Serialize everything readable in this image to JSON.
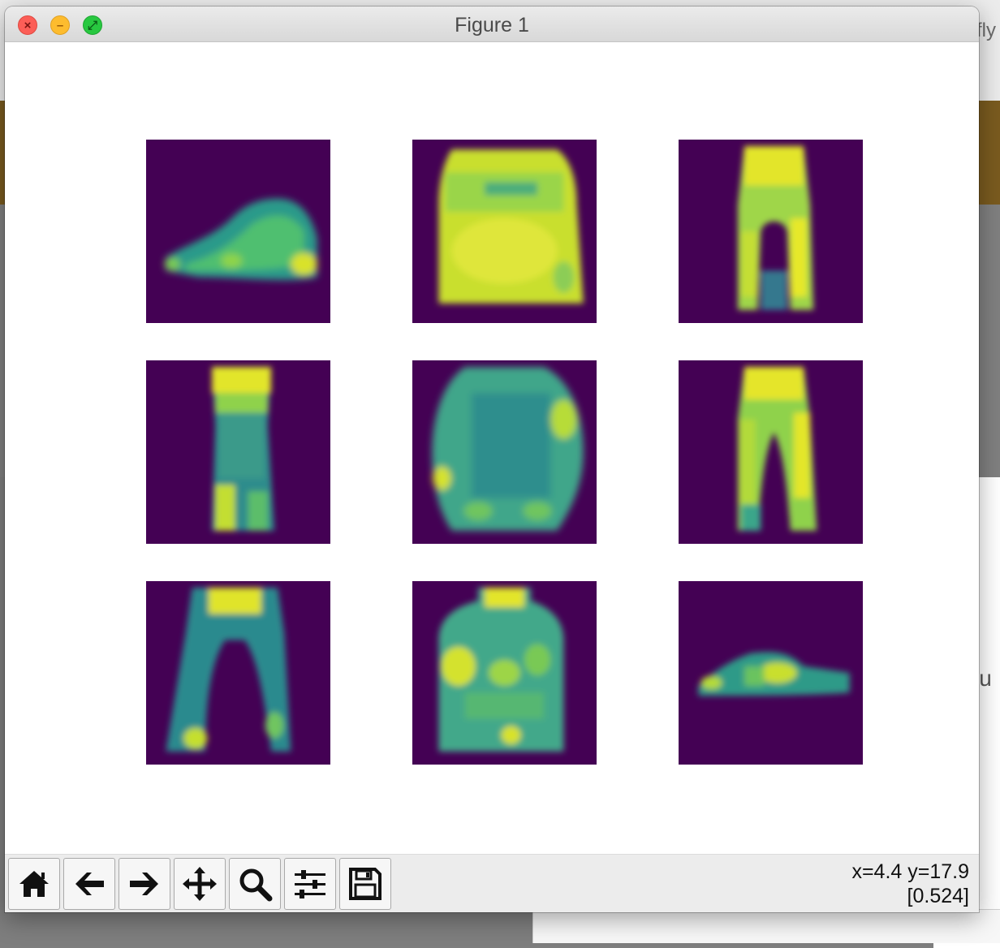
{
  "window": {
    "title": "Figure 1"
  },
  "background": {
    "right_edge_top_text": "fly",
    "right_edge_mid_text": "lu"
  },
  "figure": {
    "colormap": "viridis",
    "panels": [
      {
        "subject": "sneaker"
      },
      {
        "subject": "bag"
      },
      {
        "subject": "trouser"
      },
      {
        "subject": "trouser"
      },
      {
        "subject": "bag"
      },
      {
        "subject": "trouser"
      },
      {
        "subject": "trouser"
      },
      {
        "subject": "pullover"
      },
      {
        "subject": "sneaker"
      }
    ]
  },
  "toolbar": {
    "buttons": [
      {
        "name": "home",
        "icon": "home-icon"
      },
      {
        "name": "back",
        "icon": "arrow-left-icon"
      },
      {
        "name": "forward",
        "icon": "arrow-right-icon"
      },
      {
        "name": "pan",
        "icon": "move-icon"
      },
      {
        "name": "zoom",
        "icon": "magnifier-icon"
      },
      {
        "name": "configure-subplots",
        "icon": "sliders-icon"
      },
      {
        "name": "save",
        "icon": "floppy-icon"
      }
    ],
    "cursor_xy": "x=4.4 y=17.9",
    "cursor_value": "[0.524]"
  }
}
